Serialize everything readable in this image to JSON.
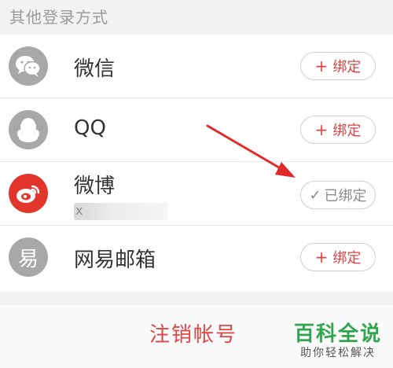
{
  "section": {
    "title": "其他登录方式"
  },
  "accounts": [
    {
      "name": "微信",
      "button": "绑定",
      "state": "unbound",
      "icon": "wechat-icon"
    },
    {
      "name": "QQ",
      "button": "绑定",
      "state": "unbound",
      "icon": "qq-icon"
    },
    {
      "name": "微博",
      "button": "已绑定",
      "state": "bound",
      "icon": "weibo-icon",
      "sub": "x"
    },
    {
      "name": "网易邮箱",
      "button": "绑定",
      "state": "unbound",
      "icon": "netease-mail-icon",
      "icon_char": "易"
    }
  ],
  "logout": {
    "label": "注销帐号"
  },
  "watermark": {
    "title": "百科全说",
    "subtitle": "助你轻松解决"
  },
  "colors": {
    "accent_red": "#e14444",
    "weibo_red": "#e2352b",
    "icon_gray": "#a8a8a8",
    "watermark_green": "#31a550"
  }
}
